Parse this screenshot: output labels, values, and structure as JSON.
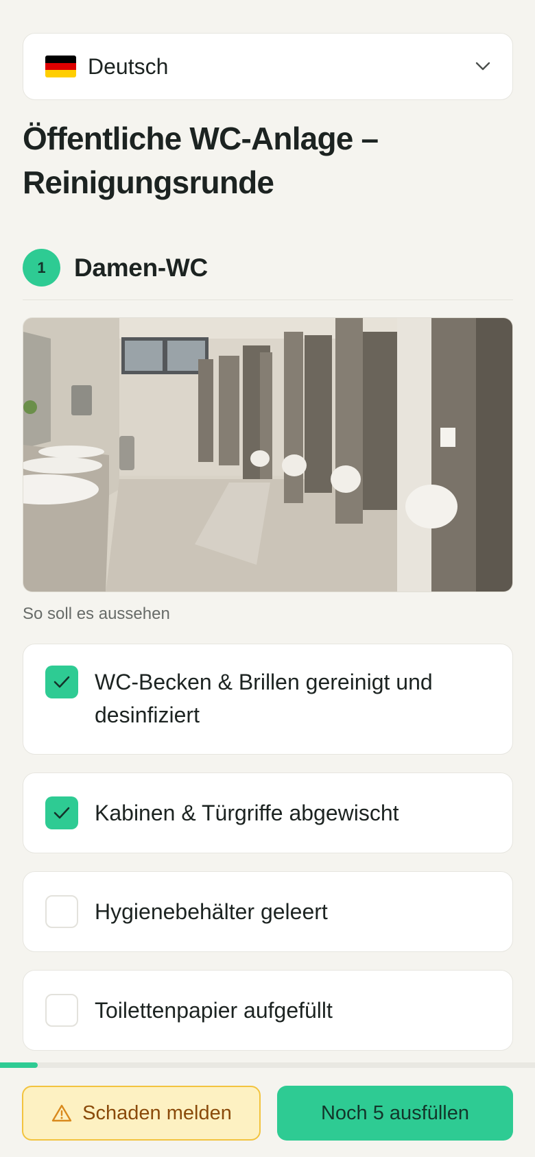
{
  "language": {
    "label": "Deutsch",
    "flag_icon": "germany-flag-icon",
    "flag_colors": [
      "#000000",
      "#dd0000",
      "#ffce00"
    ]
  },
  "title": "Öffentliche WC-Anlage – Reinigungsrunde",
  "section": {
    "number": "1",
    "title": "Damen-WC"
  },
  "reference": {
    "caption": "So soll es aussehen"
  },
  "checklist": [
    {
      "label": "WC-Becken & Brillen gereinigt und desinfiziert",
      "checked": true
    },
    {
      "label": "Kabinen & Türgriffe abgewischt",
      "checked": true
    },
    {
      "label": "Hygienebehälter geleert",
      "checked": false
    },
    {
      "label": "Toilettenpapier aufgefüllt",
      "checked": false
    }
  ],
  "progress": {
    "fraction": 0.07
  },
  "actions": {
    "report_damage": "Schaden melden",
    "fill_remaining": "Noch 5 ausfüllen"
  },
  "colors": {
    "accent": "#2ecb93",
    "warning_bg": "#fdf1c2",
    "warning_border": "#f2c33e",
    "warning_text": "#8a4a0a"
  }
}
